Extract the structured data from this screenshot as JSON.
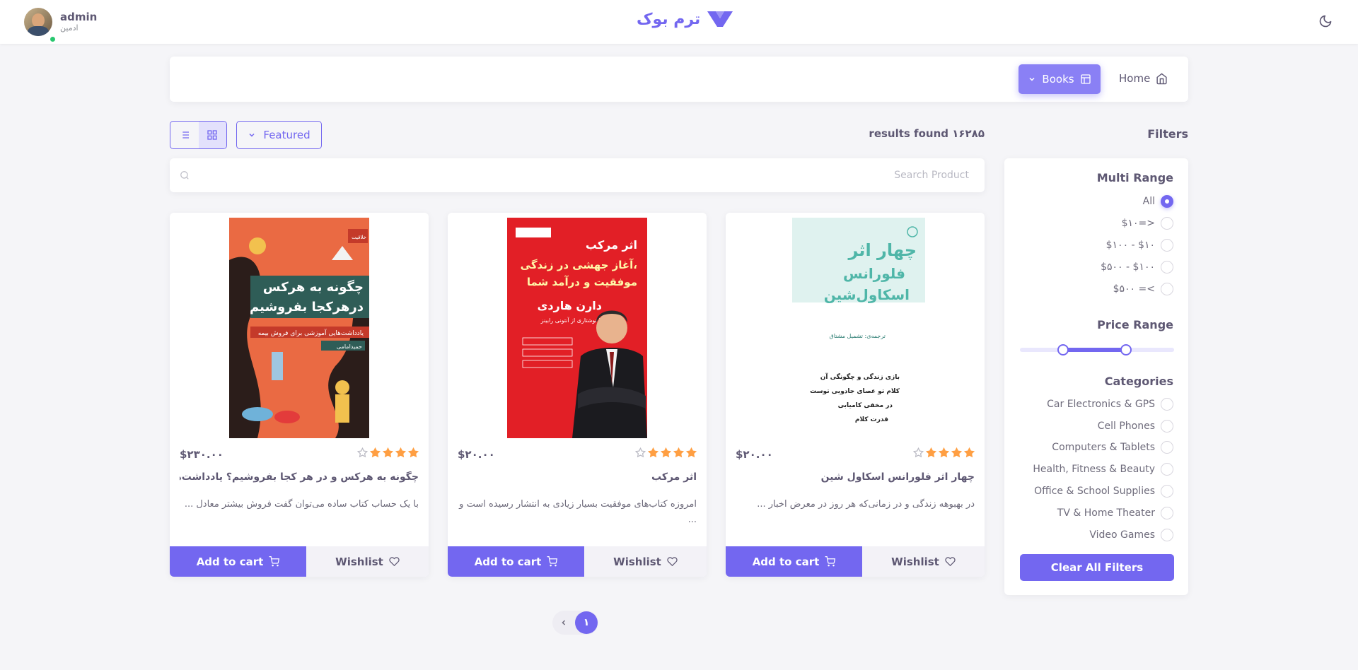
{
  "header": {
    "user_name": "admin",
    "user_role": "ادمین",
    "brand_name": "ترم بوک"
  },
  "breadcrumb": {
    "home_label": "Home",
    "books_label": "Books"
  },
  "toolbar": {
    "sort_label": "Featured",
    "results_text": "results found ۱۶۲۸۵"
  },
  "search": {
    "placeholder": "Search Product",
    "value": ""
  },
  "filters": {
    "title": "Filters",
    "multi_range_title": "Multi Range",
    "multi_range_options": [
      "All",
      "$۱۰=>",
      "$۱۰۰ - $۱۰",
      "$۵۰۰ - $۱۰۰",
      "$۵۰۰ =<"
    ],
    "multi_range_selected": "All",
    "price_range_title": "Price Range",
    "price_range_fraction": [
      0.28,
      0.69
    ],
    "categories_title": "Categories",
    "categories": [
      "Car Electronics & GPS",
      "Cell Phones",
      "Computers & Tablets",
      "Health, Fitness & Beauty",
      "Office & School Supplies",
      "TV & Home Theater",
      "Video Games"
    ],
    "clear_label": "Clear All Filters"
  },
  "products": [
    {
      "price": "$۲۳۰.۰۰",
      "rating": 4,
      "title": "چگونه به هرکس و در هر کجا بفروشیم؟ یادداشت‌های...",
      "description": "با یک حساب کتاب ساده می‌توان گفت فروش بیشتر معادل ...",
      "cover_title_line1": "چگونه به هرکس",
      "cover_title_line2": "درهرکجا بفروشیم",
      "cover_subtitle": "یادداشت‌هایی آموزشی برای فروش بیمه",
      "cover_author": "حمیدامامی",
      "cover_badge": "خلاقیت"
    },
    {
      "price": "$۲۰.۰۰",
      "rating": 4,
      "title": "اثر مرکب",
      "description": "امروزه کتاب‌های موفقیت بسیار زیادی به انتشار رسیده است و ...",
      "cover_title_line1": "اثر مرکب",
      "cover_title_line2": "آغاز جهشی در زندگی،",
      "cover_title_line3": "موفقیت و درآمد شما",
      "cover_author": "دارن هاردی",
      "cover_note": "با نوشتاری از آنتونی رابینز"
    },
    {
      "price": "$۲۰.۰۰",
      "rating": 4,
      "title": "چهار اثر فلورانس اسکاول شین",
      "description": "در بهبوهه زندگی و در زمانی‌که هر روز در معرض اخبار ...",
      "cover_title_line1": "چهار اثر",
      "cover_title_line2": "فلورانس",
      "cover_title_line3": "اسکاول‌شین",
      "cover_translator": "ترجمه‌ی: تشمیل مشتاق",
      "cover_list": [
        "بازی زندگی و چگونگی آن",
        "کلام تو عصای جادویی توست",
        "در مخفی کامیابی",
        "قدرت کلام"
      ]
    }
  ],
  "card_actions": {
    "cart_label": "Add to cart",
    "wishlist_label": "Wishlist"
  },
  "pagination": {
    "current_page": "۱"
  },
  "colors": {
    "primary": "#7367f0",
    "star": "#ff9f43",
    "online": "#28c76f"
  }
}
